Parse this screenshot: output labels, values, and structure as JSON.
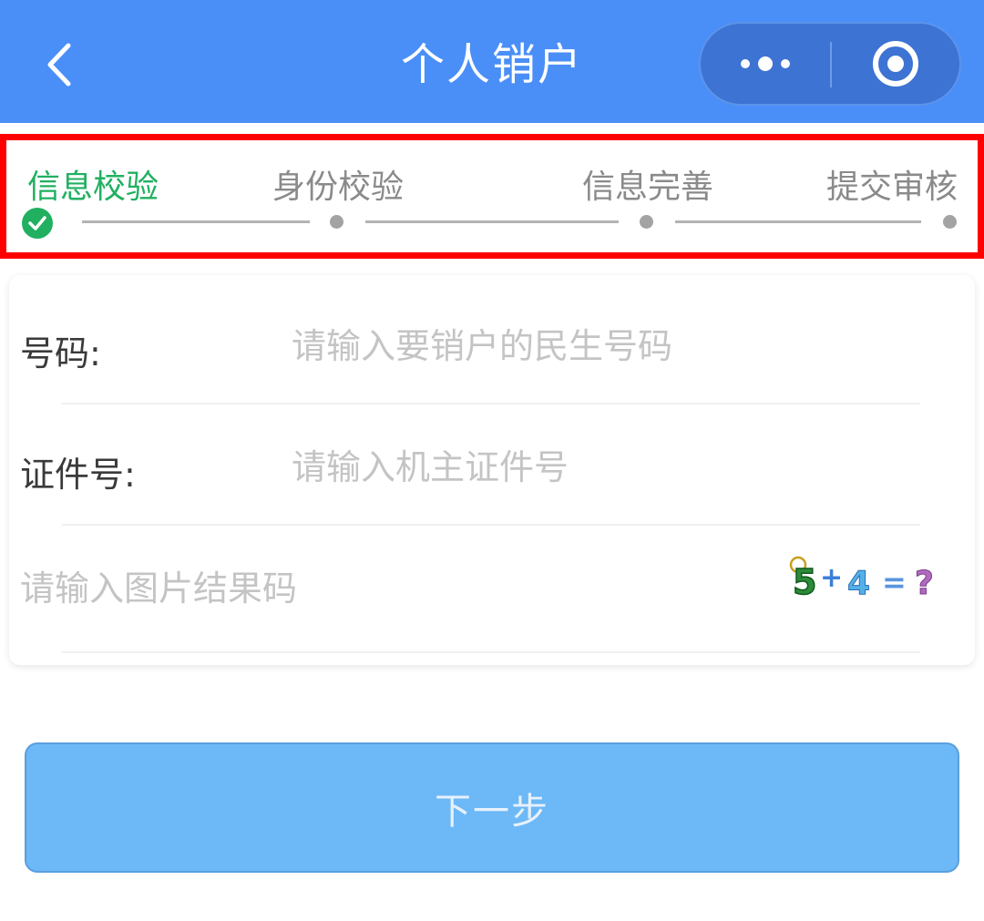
{
  "header": {
    "title": "个人销户",
    "background_color": "#4a8ff7"
  },
  "steps": {
    "items": [
      {
        "label": "信息校验",
        "state": "done"
      },
      {
        "label": "身份校验",
        "state": "pending"
      },
      {
        "label": "信息完善",
        "state": "pending"
      },
      {
        "label": "提交审核",
        "state": "pending"
      }
    ],
    "active_color": "#20b060",
    "inactive_color": "#8a8a8a",
    "highlight_border_color": "#ff0000"
  },
  "form": {
    "phone": {
      "label": "号码:",
      "placeholder": "请输入要销户的民生号码",
      "value": ""
    },
    "id_number": {
      "label": "证件号:",
      "placeholder": "请输入机主证件号",
      "value": ""
    },
    "captcha": {
      "placeholder": "请输入图片结果码",
      "value": "",
      "image_text": "5+4=?"
    }
  },
  "actions": {
    "next_label": "下一步",
    "next_color": "#6db8f6"
  }
}
